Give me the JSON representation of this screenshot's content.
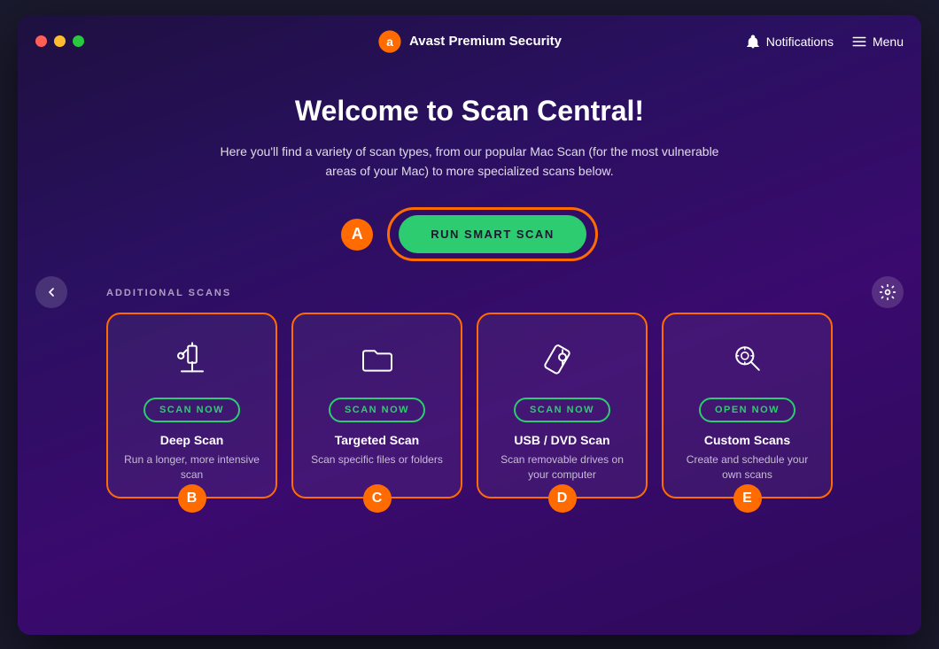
{
  "window": {
    "title": "Avast Premium Security"
  },
  "titlebar": {
    "app_name": "Avast Premium Security",
    "notifications_label": "Notifications",
    "menu_label": "Menu"
  },
  "main": {
    "page_title": "Welcome to Scan Central!",
    "page_subtitle": "Here you'll find a variety of scan types, from our popular Mac Scan (for the most vulnerable areas of your Mac) to more specialized scans below.",
    "smart_scan_label": "A",
    "smart_scan_button": "RUN SMART SCAN",
    "additional_scans_heading": "ADDITIONAL SCANS",
    "scan_cards": [
      {
        "id": "deep-scan",
        "badge": "B",
        "button_label": "SCAN NOW",
        "title": "Deep Scan",
        "description": "Run a longer, more intensive scan",
        "icon": "microscope"
      },
      {
        "id": "targeted-scan",
        "badge": "C",
        "button_label": "SCAN NOW",
        "title": "Targeted Scan",
        "description": "Scan specific files or folders",
        "icon": "folder"
      },
      {
        "id": "usb-dvd-scan",
        "badge": "D",
        "button_label": "SCAN NOW",
        "title": "USB / DVD Scan",
        "description": "Scan removable drives on your computer",
        "icon": "usb"
      },
      {
        "id": "custom-scans",
        "badge": "E",
        "button_label": "OPEN NOW",
        "title": "Custom Scans",
        "description": "Create and schedule your own scans",
        "icon": "gear-search"
      }
    ]
  },
  "colors": {
    "accent_orange": "#ff6b00",
    "accent_green": "#2ecc71",
    "background_dark": "#1e1040"
  }
}
